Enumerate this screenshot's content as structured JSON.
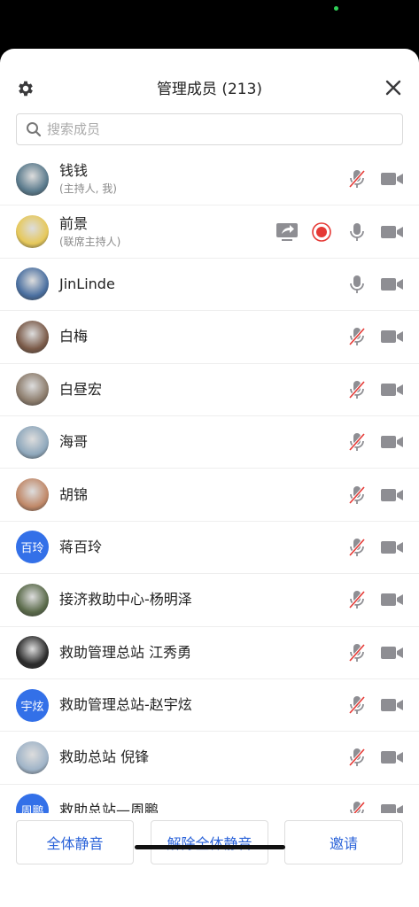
{
  "header": {
    "title": "管理成员 (213)"
  },
  "search": {
    "placeholder": "搜索成员"
  },
  "members": [
    {
      "name": "钱钱",
      "role": "(主持人, 我)",
      "avatar": "photo",
      "avatar_color": "#5a7a8c",
      "mic": "muted",
      "camera": "off"
    },
    {
      "name": "前景",
      "role": "(联席主持人)",
      "avatar": "photo",
      "avatar_color": "#e6c85a",
      "mic": "on",
      "camera": "off",
      "sharing": true,
      "recording": true
    },
    {
      "name": "JinLinde",
      "avatar": "photo",
      "avatar_color": "#4a6fa0",
      "mic": "on",
      "camera": "off"
    },
    {
      "name": "白梅",
      "avatar": "photo",
      "avatar_color": "#7a5a48",
      "mic": "muted",
      "camera": "off"
    },
    {
      "name": "白昼宏",
      "avatar": "photo",
      "avatar_color": "#8c7c6c",
      "mic": "muted",
      "camera": "off"
    },
    {
      "name": "海哥",
      "avatar": "photo",
      "avatar_color": "#8fa8bc",
      "mic": "muted",
      "camera": "off"
    },
    {
      "name": "胡锦",
      "avatar": "photo",
      "avatar_color": "#c08868",
      "mic": "muted",
      "camera": "off"
    },
    {
      "name": "蒋百玲",
      "avatar": "text",
      "avatar_text": "百玲",
      "mic": "muted",
      "camera": "off"
    },
    {
      "name": "接济救助中心-杨明泽",
      "avatar": "photo",
      "avatar_color": "#5a6a4a",
      "mic": "muted",
      "camera": "off"
    },
    {
      "name": "救助管理总站 江秀勇",
      "avatar": "photo",
      "avatar_color": "#2a2a2a",
      "mic": "muted",
      "camera": "off"
    },
    {
      "name": "救助管理总站-赵宇炫",
      "avatar": "text",
      "avatar_text": "宇炫",
      "mic": "muted",
      "camera": "off"
    },
    {
      "name": "救助总站 倪锋",
      "avatar": "photo",
      "avatar_color": "#a0b4c8",
      "mic": "muted",
      "camera": "off"
    },
    {
      "name": "救助总站—周鹏",
      "avatar": "text",
      "avatar_text": "周鹏",
      "mic": "muted",
      "camera": "off"
    }
  ],
  "footer": {
    "mute_all": "全体静音",
    "unmute_all": "解除全体静音",
    "invite": "邀请"
  },
  "colors": {
    "accent": "#2b63d9",
    "muted_red": "#e53935",
    "icon_gray": "#8e8e93",
    "record_red": "#e53935"
  }
}
